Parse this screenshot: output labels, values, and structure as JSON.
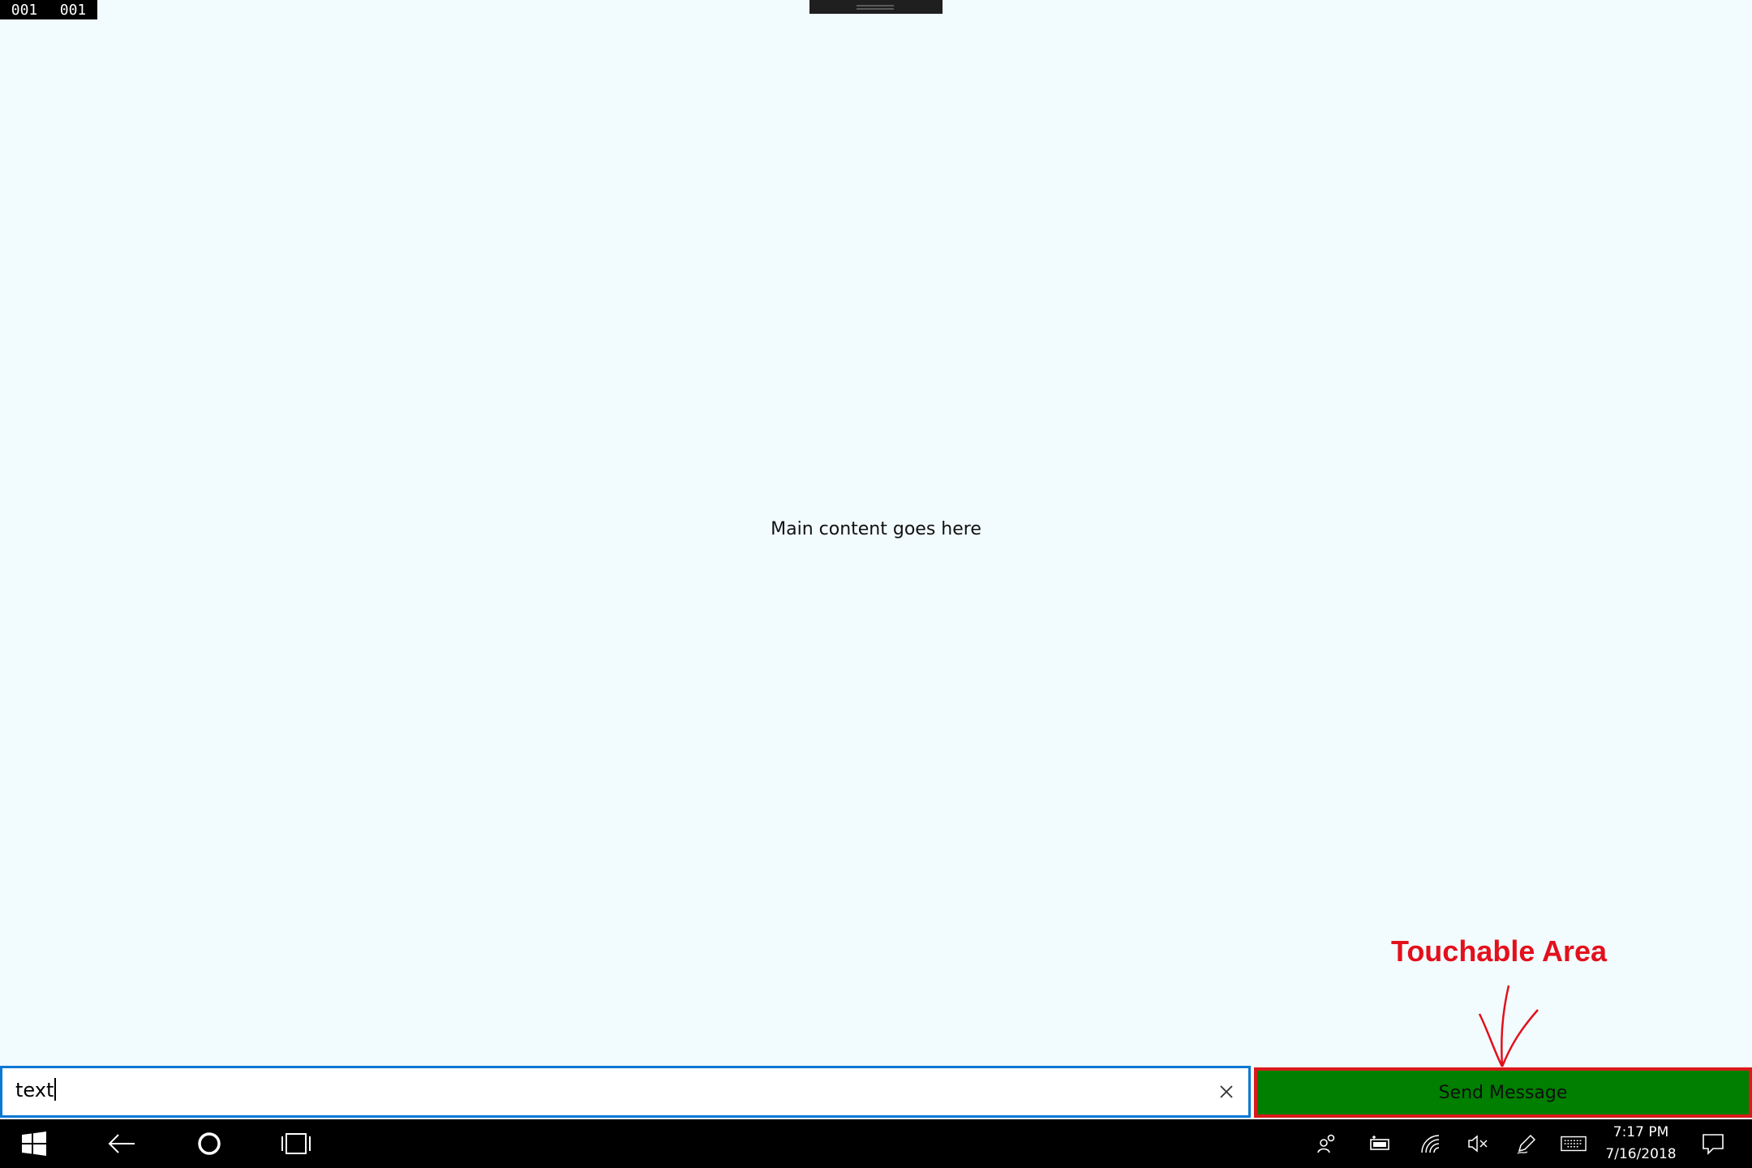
{
  "corner_counter": {
    "left": "001",
    "right": "001"
  },
  "main": {
    "content_text": "Main content goes here"
  },
  "annotation": {
    "label": "Touchable Area",
    "color": "#e3101c"
  },
  "composer": {
    "input_value": "text",
    "send_label": "Send Message",
    "send_color": "#007f00",
    "send_border_color": "#d91a1a",
    "input_border_color": "#0a78d4"
  },
  "taskbar": {
    "left_icons": [
      "windows-start-icon",
      "back-arrow-icon",
      "cortana-circle-icon",
      "task-view-icon"
    ],
    "tray_icons": [
      "people-icon",
      "battery-icon",
      "wifi-icon",
      "volume-muted-icon",
      "pen-workspace-icon",
      "touch-keyboard-icon"
    ],
    "time": "7:17 PM",
    "date": "7/16/2018",
    "right_icon": "action-center-icon"
  }
}
